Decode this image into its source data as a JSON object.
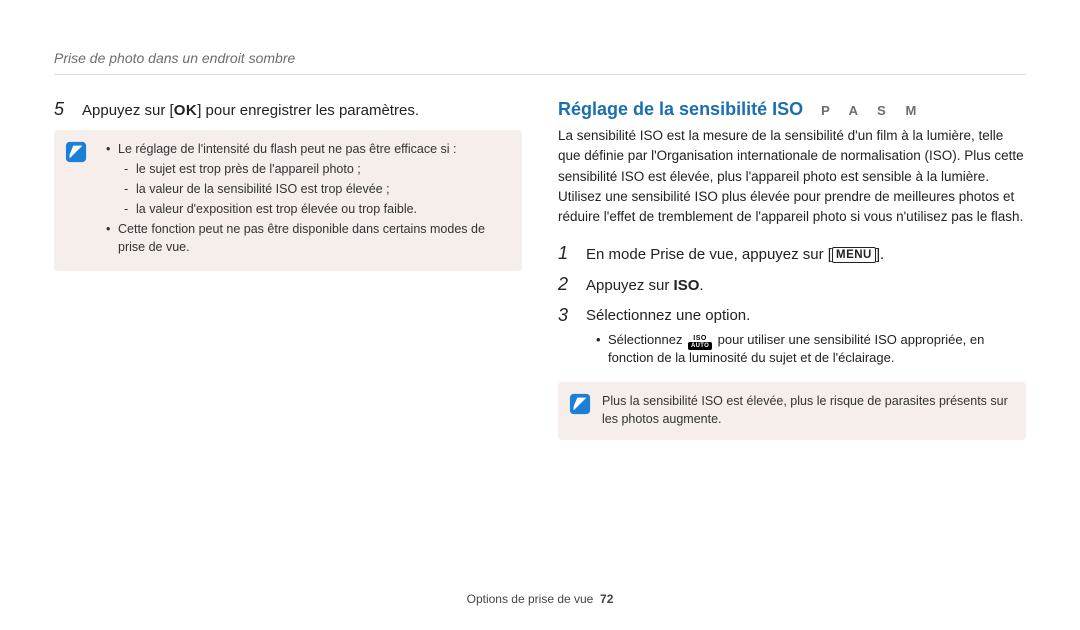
{
  "breadcrumb": "Prise de photo dans un endroit sombre",
  "left": {
    "step5_num": "5",
    "step5_pre": "Appuyez sur [",
    "step5_ok": "OK",
    "step5_post": "] pour enregistrer les paramètres.",
    "note": {
      "bullet1": "Le réglage de l'intensité du flash peut ne pas être efficace si :",
      "sub1": "le sujet est trop près de l'appareil photo ;",
      "sub2": "la valeur de la sensibilité ISO est trop élevée ;",
      "sub3": "la valeur d'exposition est trop élevée ou trop faible.",
      "bullet2": "Cette fonction peut ne pas être disponible dans certains modes de prise de vue."
    }
  },
  "right": {
    "title": "Réglage de la sensibilité ISO",
    "modes": "P A S M",
    "intro": "La sensibilité ISO est la mesure de la sensibilité d'un film à la lumière, telle que définie par l'Organisation internationale de normalisation (ISO). Plus cette sensibilité ISO est élevée, plus l'appareil photo est sensible à la lumière. Utilisez une sensibilité ISO plus élevée pour prendre de meilleures photos et réduire l'effet de tremblement de l'appareil photo si vous n'utilisez pas le flash.",
    "step1_num": "1",
    "step1_pre": "En mode Prise de vue, appuyez sur [",
    "step1_menu": "MENU",
    "step1_post": "].",
    "step2_num": "2",
    "step2_pre": "Appuyez sur ",
    "step2_bold": "ISO",
    "step2_post": ".",
    "step3_num": "3",
    "step3_text": "Sélectionnez une option.",
    "step3_bullet_pre": "Sélectionnez ",
    "step3_bullet_iso_top": "ISO",
    "step3_bullet_iso_bot": "AUTO",
    "step3_bullet_post": " pour utiliser une sensibilité ISO appropriée, en fonction de la luminosité du sujet et de l'éclairage.",
    "note": "Plus la sensibilité ISO est élevée, plus le risque de parasites présents sur les photos augmente."
  },
  "footer": {
    "section": "Options de prise de vue",
    "page": "72"
  },
  "icons": {
    "info": "info-icon"
  }
}
